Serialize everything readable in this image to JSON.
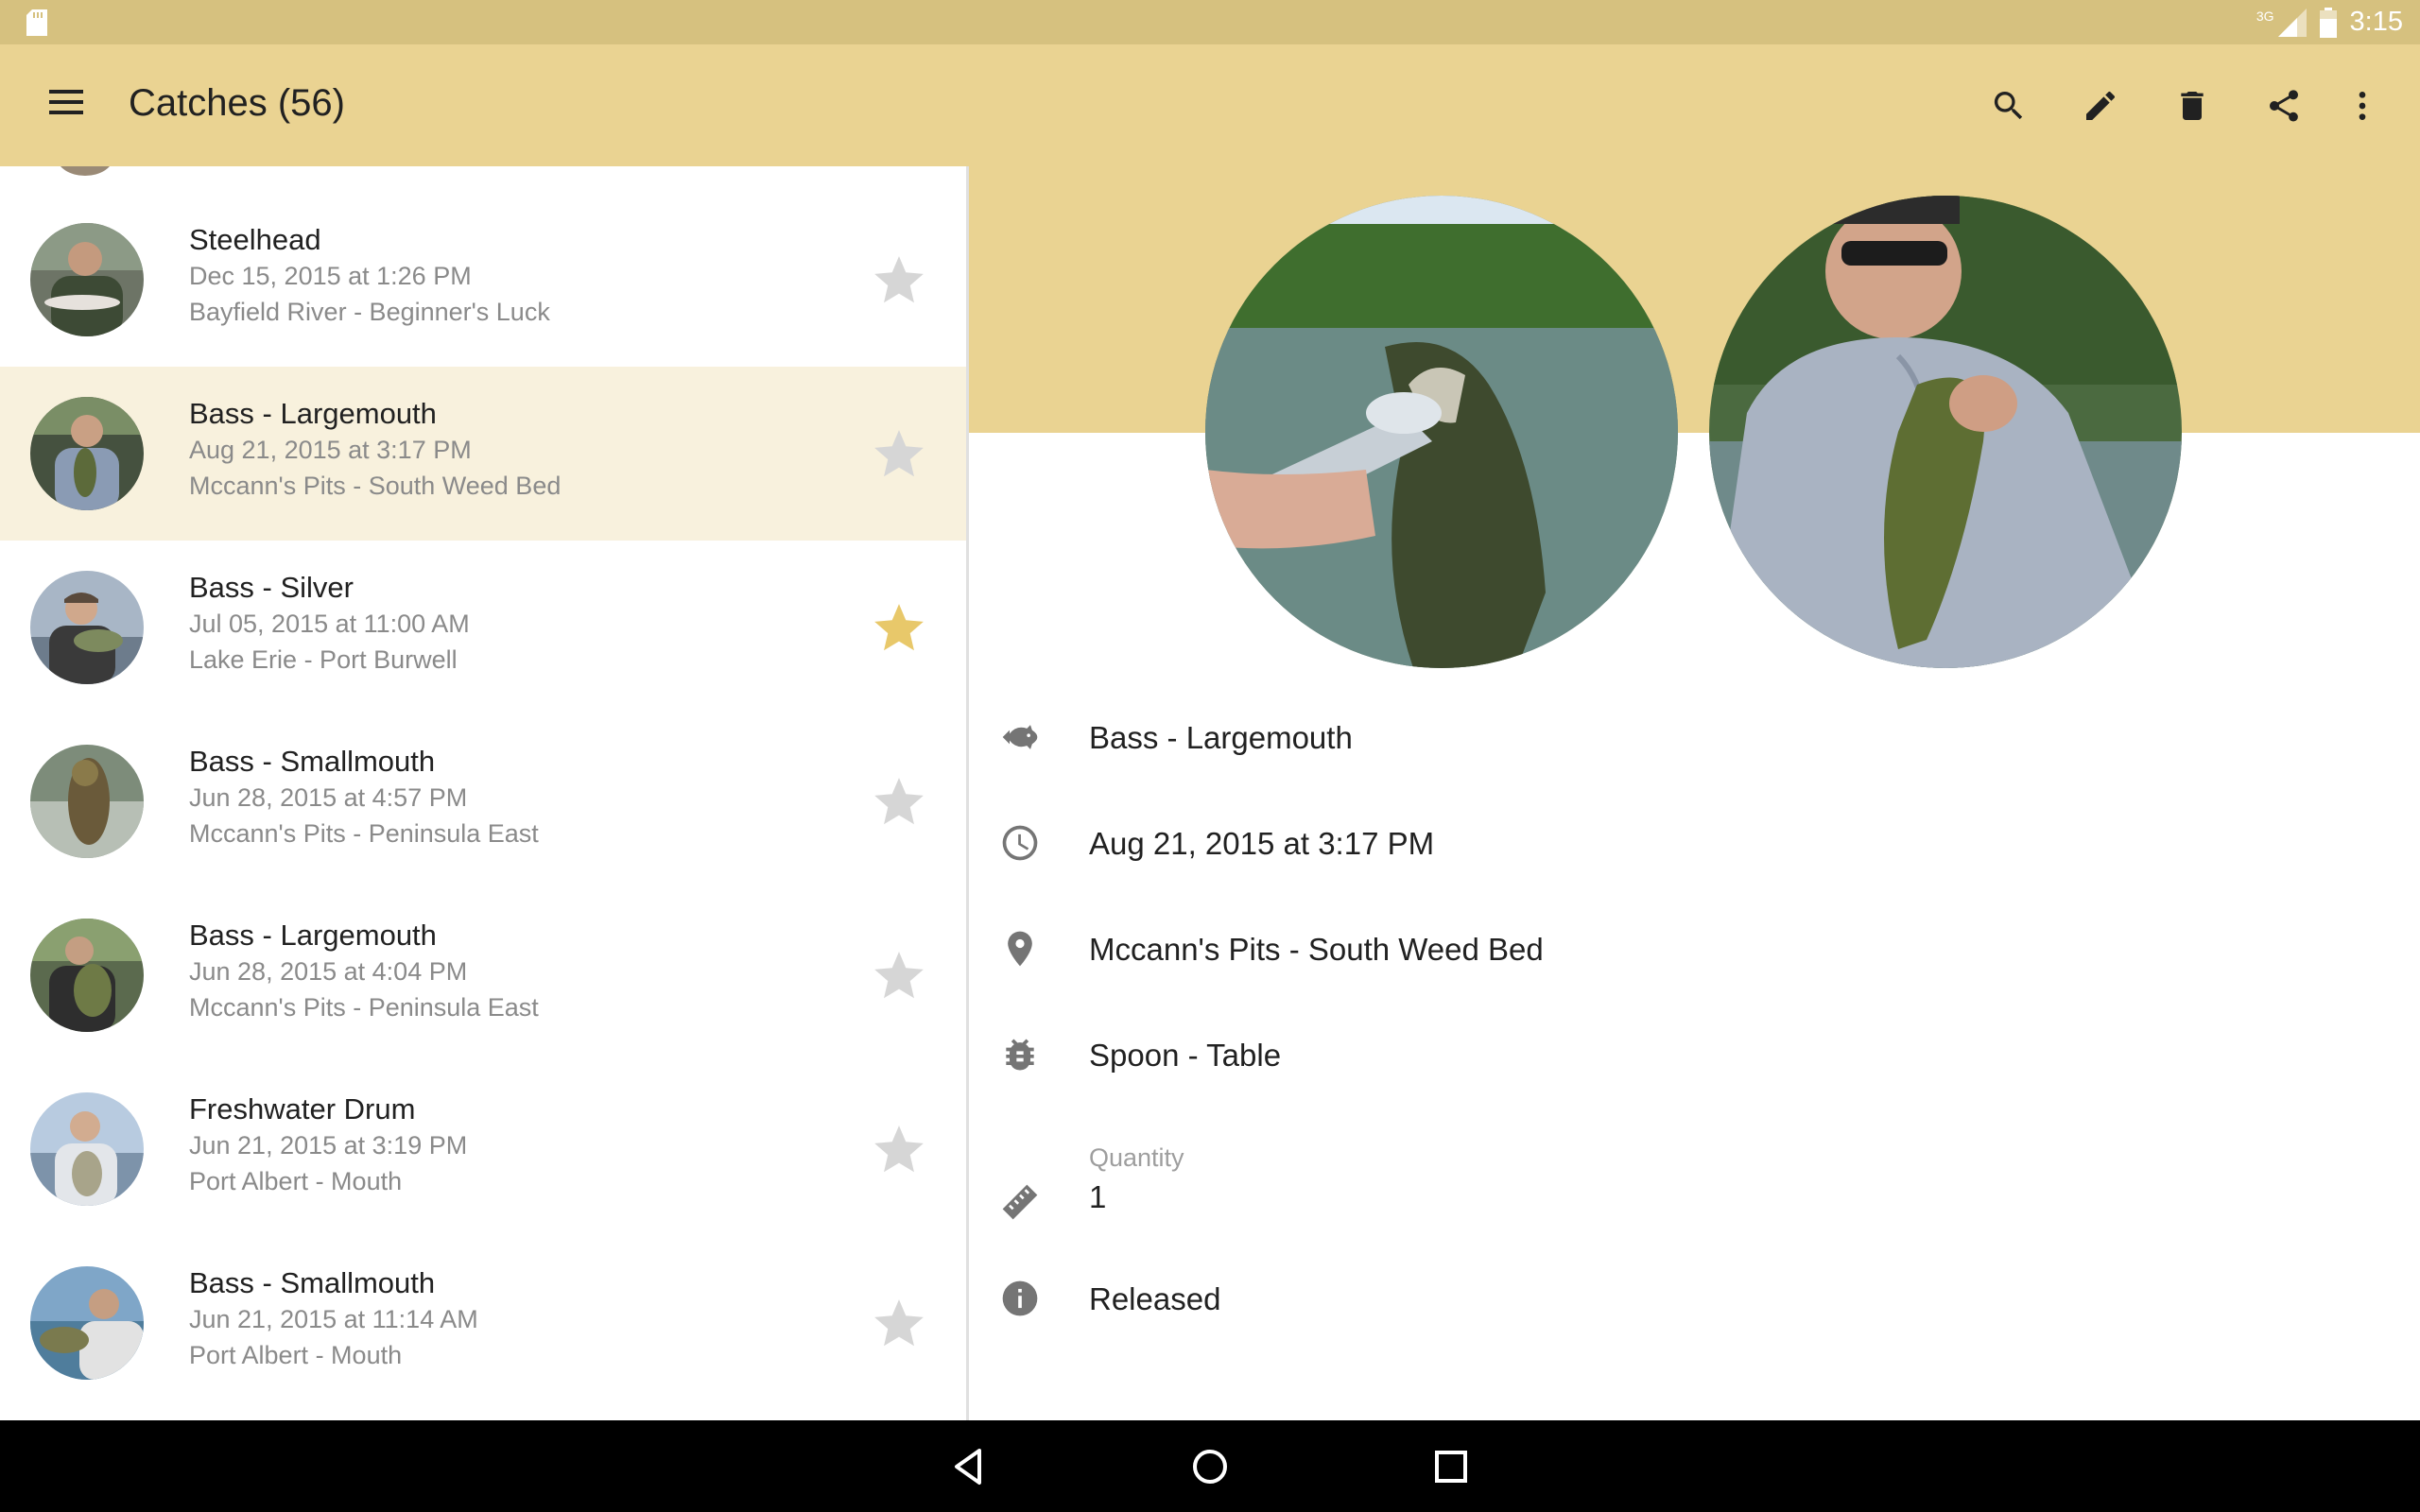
{
  "status_bar": {
    "network": "3G",
    "time": "3:15"
  },
  "app_bar": {
    "title": "Catches (56)",
    "actions": [
      "search-icon",
      "edit-icon",
      "delete-icon",
      "share-icon",
      "more-vert-icon"
    ]
  },
  "catches": [
    {
      "species": "Steelhead",
      "date": "Dec 15, 2015 at 1:26 PM",
      "location": "Bayfield River - Beginner's Luck",
      "favorite": false
    },
    {
      "species": "Bass - Largemouth",
      "date": "Aug 21, 2015 at 3:17 PM",
      "location": "Mccann's Pits - South Weed Bed",
      "favorite": false
    },
    {
      "species": "Bass - Silver",
      "date": "Jul 05, 2015 at 11:00 AM",
      "location": "Lake Erie - Port Burwell",
      "favorite": true
    },
    {
      "species": "Bass - Smallmouth",
      "date": "Jun 28, 2015 at 4:57 PM",
      "location": "Mccann's Pits - Peninsula East",
      "favorite": false
    },
    {
      "species": "Bass - Largemouth",
      "date": "Jun 28, 2015 at 4:04 PM",
      "location": "Mccann's Pits - Peninsula East",
      "favorite": false
    },
    {
      "species": "Freshwater Drum",
      "date": "Jun 21, 2015 at 3:19 PM",
      "location": "Port Albert - Mouth",
      "favorite": false
    },
    {
      "species": "Bass - Smallmouth",
      "date": "Jun 21, 2015 at 11:14 AM",
      "location": "Port Albert - Mouth",
      "favorite": false
    }
  ],
  "detail": {
    "species": "Bass - Largemouth",
    "date": "Aug 21, 2015 at 3:17 PM",
    "location": "Mccann's Pits - South Weed Bed",
    "bait": "Spoon - Table",
    "quantity_label": "Quantity",
    "quantity": "1",
    "release": "Released"
  },
  "colors": {
    "primary": "#ead392",
    "status": "#d6c17f",
    "selected": "#f8f1dd",
    "star_on": "#e8c86a",
    "star_off": "#d6d6d6"
  }
}
